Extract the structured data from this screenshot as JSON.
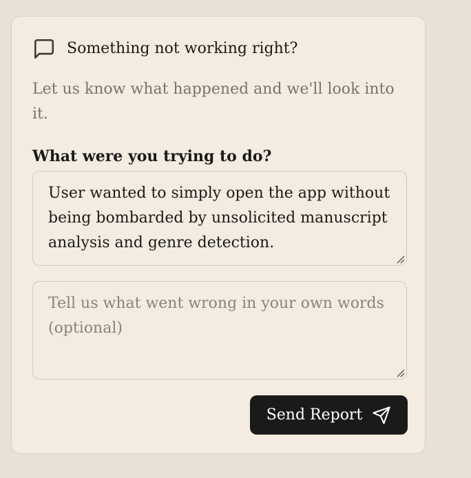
{
  "header": {
    "icon": "message-square-icon",
    "title": "Something not working right?"
  },
  "subtitle": "Let us know what happened and we'll look into it.",
  "question": "What were you trying to do?",
  "task_field": {
    "value": "User wanted to simply open the app without being bombarded by unsolicited manuscript analysis and genre detection."
  },
  "details_field": {
    "placeholder": "Tell us what went wrong in your own words (optional)"
  },
  "send_button": {
    "label": "Send Report",
    "icon": "send-icon"
  },
  "colors": {
    "background": "#e9e0d6",
    "card": "#f4ece0",
    "button": "#1a1a1a"
  }
}
